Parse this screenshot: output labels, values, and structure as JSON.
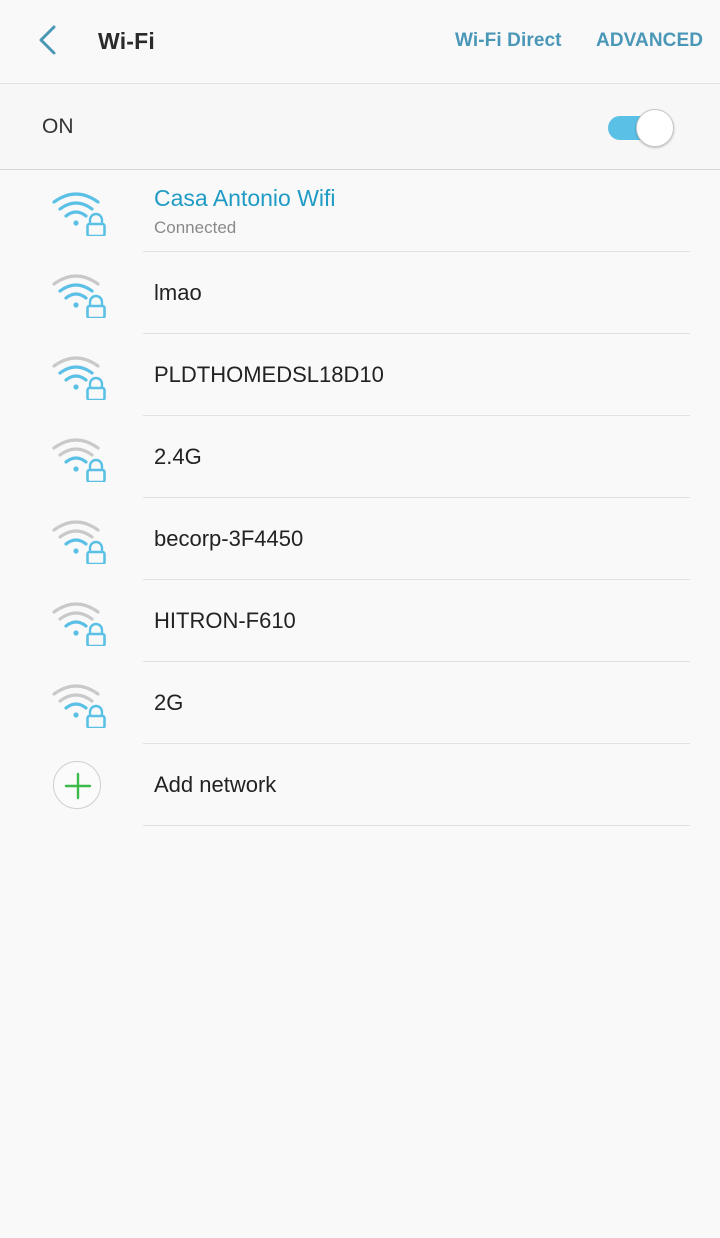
{
  "header": {
    "title": "Wi-Fi",
    "wifi_direct_label": "Wi-Fi Direct",
    "advanced_label": "ADVANCED"
  },
  "master_toggle": {
    "label": "ON",
    "state": "on"
  },
  "networks": [
    {
      "name": "Casa Antonio Wifi",
      "status": "Connected",
      "secured": true,
      "signal_bars": 4,
      "connected": true
    },
    {
      "name": "lmao",
      "secured": true,
      "signal_bars": 3
    },
    {
      "name": "PLDTHOMEDSL18D10",
      "secured": true,
      "signal_bars": 3
    },
    {
      "name": "2.4G",
      "secured": true,
      "signal_bars": 2
    },
    {
      "name": "becorp-3F4450",
      "secured": true,
      "signal_bars": 2
    },
    {
      "name": "HITRON-F610",
      "secured": true,
      "signal_bars": 2
    },
    {
      "name": "2G",
      "secured": true,
      "signal_bars": 2
    }
  ],
  "add_network": {
    "label": "Add network",
    "icon": "plus-icon"
  },
  "icons": {
    "back": "chevron-left-icon",
    "wifi": "wifi-lock-icon"
  },
  "colors": {
    "accent": "#3fa6c8",
    "header_action": "#4a97b8",
    "connected_name": "#1f9bc4",
    "toggle_track": "#5bc0e6",
    "wifi_active": "#5bc0e6",
    "wifi_inactive": "#c9c9c9",
    "add_plus": "#3dbb4a"
  }
}
